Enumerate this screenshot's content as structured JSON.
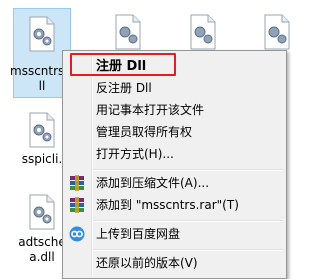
{
  "desktop": {
    "files": [
      {
        "name": "msscntrs.d\nll",
        "selected": true
      },
      {
        "name": "sspicli.",
        "selected": false
      },
      {
        "name": "adtsche\na.dll",
        "selected": false
      }
    ]
  },
  "context_menu": {
    "items": [
      {
        "label": "注册 Dll",
        "icon": "",
        "bold": true
      },
      {
        "label": "反注册 Dll",
        "icon": ""
      },
      {
        "label": "用记事本打开该文件",
        "icon": ""
      },
      {
        "label": "管理员取得所有权",
        "icon": ""
      },
      {
        "label": "打开方式(H)...",
        "icon": ""
      },
      {
        "label": "添加到压缩文件(A)...",
        "icon": "winrar-icon"
      },
      {
        "label": "添加到 \"msscntrs.rar\"(T)",
        "icon": "winrar-icon"
      },
      {
        "label": "上传到百度网盘",
        "icon": "baidu-netdisk-icon"
      },
      {
        "label": "还原以前的版本(V)",
        "icon": ""
      }
    ]
  },
  "colors": {
    "selection_bg": "#cde6f7",
    "highlight_border": "#e02020"
  }
}
